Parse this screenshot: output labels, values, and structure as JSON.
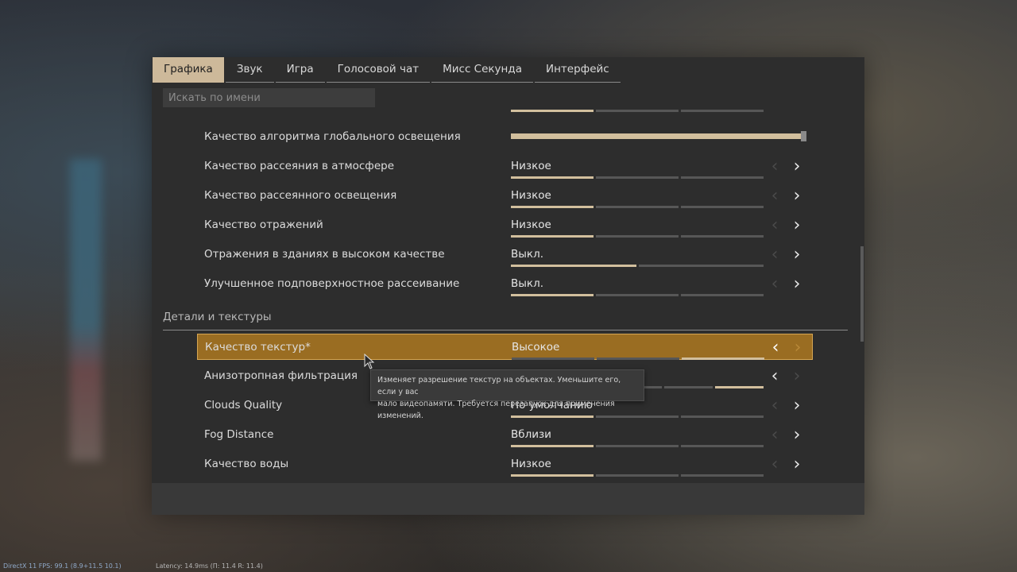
{
  "tabs": [
    {
      "label": "Графика",
      "active": true
    },
    {
      "label": "Звук",
      "active": false
    },
    {
      "label": "Игра",
      "active": false
    },
    {
      "label": "Голосовой чат",
      "active": false
    },
    {
      "label": "Мисс Секунда",
      "active": false
    },
    {
      "label": "Интерфейс",
      "active": false
    }
  ],
  "search": {
    "placeholder": "Искать по имени",
    "value": ""
  },
  "settings": [
    {
      "label": "Качество алгоритма глобального освещения",
      "value": "",
      "level": 1.0,
      "type": "slider"
    },
    {
      "label": "Качество рассеяния в атмосфере",
      "value": "Низкое",
      "level": 0.33,
      "type": "option"
    },
    {
      "label": "Качество рассеянного освещения",
      "value": "Низкое",
      "level": 0.33,
      "type": "option"
    },
    {
      "label": "Качество отражений",
      "value": "Низкое",
      "level": 0.33,
      "type": "option"
    },
    {
      "label": "Отражения в зданиях в высоком качестве",
      "value": "Выкл.",
      "level": 0.5,
      "type": "option"
    },
    {
      "label": "Улучшенное подповерхностное рассеивание",
      "value": "Выкл.",
      "level": 0.33,
      "type": "option"
    }
  ],
  "section_title": "Детали и текстуры",
  "details": [
    {
      "label": "Качество текстур*",
      "value": "Высокое",
      "level": 1.0,
      "selected": true
    },
    {
      "label": "Анизотропная фильтрация",
      "value": "",
      "level": 1.0
    },
    {
      "label": "Clouds Quality",
      "value": "По умолчанию",
      "level": 0.33
    },
    {
      "label": "Fog Distance",
      "value": "Вблизи",
      "level": 0.33
    },
    {
      "label": "Качество воды",
      "value": "Низкое",
      "level": 0.33
    }
  ],
  "tooltip": {
    "line1": "Изменяет разрешение текстур на объектах. Уменьшите его, если у вас",
    "line2": "мало видеопамяти. Требуется перезапуск для применения изменений."
  },
  "status": {
    "left": "DirectX 11 FPS: 99.1 (8.9+11.5 10.1)",
    "mid": "Latency: 14.9ms (П: 11.4 R: 11.4)"
  },
  "colors": {
    "accent": "#cdb99a",
    "selected": "#9a6d22",
    "panel": "#2d2d2d"
  }
}
